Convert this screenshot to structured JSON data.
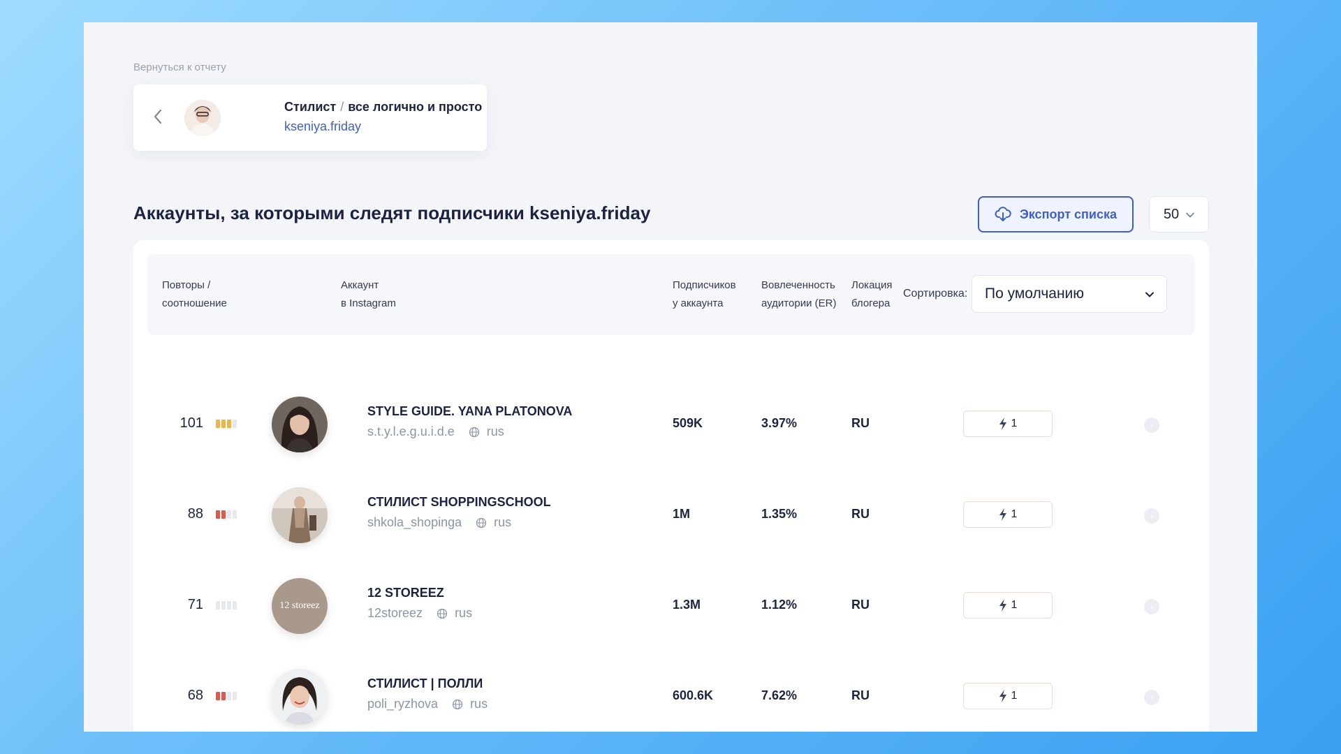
{
  "back_link": "Вернуться к отчету",
  "profile": {
    "name": "Стилист",
    "separator": "/",
    "tagline": "все логично и просто",
    "handle": "kseniya.friday"
  },
  "page_title": "Аккаунты, за которыми следят подписчики kseniya.friday",
  "export_label": "Экспорт списка",
  "per_page": "50",
  "table_headers": {
    "repeats_line1": "Повторы /",
    "repeats_line2": "соотношение",
    "account_line1": "Аккаунт",
    "account_line2": "в Instagram",
    "subs_line1": "Подписчиков",
    "subs_line2": "у аккаунта",
    "er_line1": "Вовлеченность",
    "er_line2": "аудитории (ER)",
    "loc_line1": "Локация",
    "loc_line2": "блогера"
  },
  "sort": {
    "label": "Сортировка:",
    "value": "По умолчанию"
  },
  "colors": {
    "accent": "#3f5fc8",
    "bar_gold": "#f0b44a",
    "bar_red": "#e2574c",
    "bar_empty": "#e6e8ee"
  },
  "rows": [
    {
      "repeats": "101",
      "bars_filled": 3,
      "bars_color": "gold",
      "title": "STYLE GUIDE. YANA PLATONOVA",
      "handle": "s.t.y.l.e.g.u.i.d.e",
      "lang": "rus",
      "subscribers": "509K",
      "er": "3.97%",
      "location": "RU",
      "boost": "1"
    },
    {
      "repeats": "88",
      "bars_filled": 2,
      "bars_color": "red",
      "title": "СТИЛИСТ SHOPPINGSCHOOL",
      "handle": "shkola_shopinga",
      "lang": "rus",
      "subscribers": "1M",
      "er": "1.35%",
      "location": "RU",
      "boost": "1"
    },
    {
      "repeats": "71",
      "bars_filled": 0,
      "bars_color": "none",
      "title": "12 STOREEZ",
      "handle": "12storeez",
      "lang": "rus",
      "subscribers": "1.3M",
      "er": "1.12%",
      "location": "RU",
      "boost": "1",
      "avatar_text": "12 storeez"
    },
    {
      "repeats": "68",
      "bars_filled": 2,
      "bars_color": "red",
      "title": "СТИЛИСТ | ПОЛЛИ",
      "handle": "poli_ryzhova",
      "lang": "rus",
      "subscribers": "600.6K",
      "er": "7.62%",
      "location": "RU",
      "boost": "1"
    }
  ]
}
